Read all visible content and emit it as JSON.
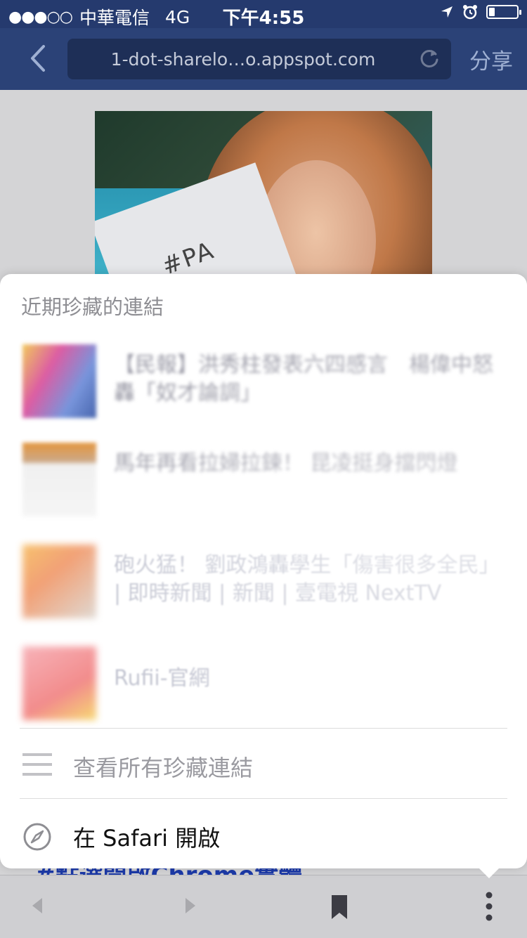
{
  "status_bar": {
    "signal": "●●●○○",
    "carrier": "中華電信",
    "network": "4G",
    "time": "下午4:55"
  },
  "navbar": {
    "url": "1-dot-sharelo…o.appspot.com",
    "share_label": "分享"
  },
  "web": {
    "photo_text": "#PA",
    "link_text": "#點選開啟Chrome實體"
  },
  "popover": {
    "title": "近期珍藏的連結",
    "bookmarks": [
      {
        "title": "【民報】洪秀柱發表六四感言　楊偉中怒轟「奴才論調」"
      },
      {
        "title": "馬年再看拉婦拉鍊！ 昆凌挺身擋閃燈"
      },
      {
        "title": "砲火猛！ 劉政鴻轟學生「傷害很多全民」 | 即時新聞 | 新聞 | 壹電視 NextTV"
      },
      {
        "title": "Rufii-官網"
      }
    ],
    "view_all_label": "查看所有珍藏連結",
    "open_safari_label": "在 Safari 開啟"
  },
  "colors": {
    "nav_bg": "#2b4277",
    "status_bg": "#253a6e",
    "popover_bg": "#ffffff",
    "muted_text": "#9a9aa0"
  },
  "icons": {
    "back": "chevron-left-icon",
    "reload": "reload-icon",
    "location": "location-arrow-icon",
    "alarm": "alarm-clock-icon",
    "battery": "battery-icon",
    "list": "list-icon",
    "compass": "compass-icon",
    "bookmark": "bookmark-icon",
    "more": "more-vertical-icon"
  }
}
